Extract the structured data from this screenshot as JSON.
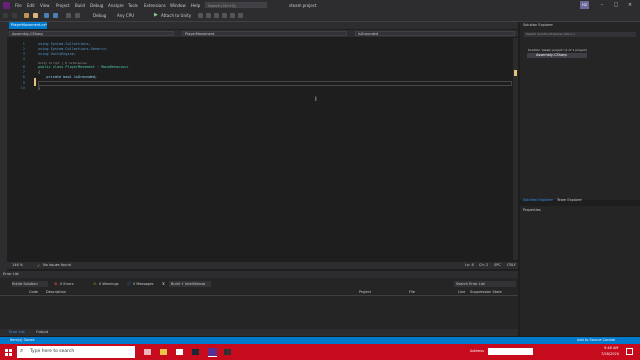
{
  "titlebar": {
    "menu": [
      "File",
      "Edit",
      "View",
      "Project",
      "Build",
      "Debug",
      "Analyze",
      "Tools",
      "Extensions",
      "Window",
      "Help"
    ],
    "search_placeholder": "Search (Ctrl+Q)",
    "project_title": "steam project",
    "avatar_initials": "HZ"
  },
  "toolbar": {
    "config": "Debug",
    "platform": "Any CPU",
    "attach": "Attach to Unity"
  },
  "editor": {
    "tab_label": "PlayerMovement.cs*",
    "nav": {
      "project": "Assembly-CSharp",
      "class": "PlayerMovement",
      "member": "isGrounded"
    },
    "lines": [
      {
        "n": "1",
        "text": "using System.Collections;"
      },
      {
        "n": "2",
        "text": "using System.Collections.Generic;"
      },
      {
        "n": "3",
        "text": "using UnityEngine;"
      },
      {
        "n": "4",
        "text": ""
      },
      {
        "n": "5",
        "text": "Unity Script | 0 references"
      },
      {
        "n": "6",
        "text": "public class PlayerMovement : MonoBehaviour"
      },
      {
        "n": "7",
        "text": "{"
      },
      {
        "n": "8",
        "text": "    private bool isGrounded;"
      },
      {
        "n": "9",
        "text": ""
      },
      {
        "n": "10",
        "text": "}"
      }
    ],
    "status": {
      "zoom": "146 %",
      "issues": "No issues found",
      "ln": "Ln: 8",
      "ch": "Ch: 2",
      "spc": "SPC",
      "crlf": "CRLF"
    }
  },
  "error_list": {
    "title": "Error List",
    "scope": "Entire Solution",
    "errors": "0 Errors",
    "warnings": "0 Warnings",
    "messages": "0 Messages",
    "build": "Build + IntelliSense",
    "search": "Search Error List",
    "columns": [
      "Code",
      "Description",
      "Project",
      "File",
      "Line",
      "Suppression State"
    ],
    "tabs": [
      "Error List",
      "Output"
    ]
  },
  "solution_explorer": {
    "title": "Solution Explorer",
    "search": "Search Solution Explorer (Ctrl+;)",
    "solution": "Solution 'steam project' (1 of 1 project)",
    "project": "Assembly-CSharp",
    "tabs": [
      "Solution Explorer",
      "Team Explorer"
    ]
  },
  "properties": {
    "title": "Properties"
  },
  "statusbar": {
    "left": "Item(s) Saved",
    "right": "Add to Source Control"
  },
  "taskbar": {
    "search": "Type here to search",
    "tray_text": "Address",
    "time": "9:48 AM",
    "date": "7/28/2020"
  },
  "colors": {
    "accent": "#007acc",
    "taskbar": "#c50b1c",
    "titlebar": "#2d2d30",
    "editor_bg": "#1e1e1e"
  }
}
